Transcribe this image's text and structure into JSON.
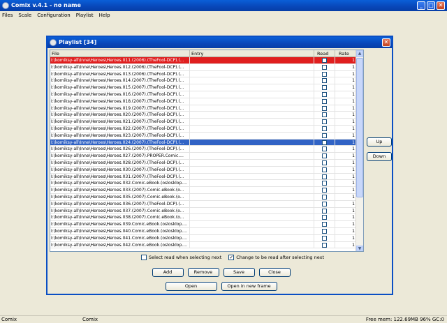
{
  "window": {
    "title": "Comix v.4.1 - no name"
  },
  "menu": [
    "Files",
    "Scale",
    "Configuration",
    "Playlist",
    "Help"
  ],
  "dialog": {
    "title": "Playlist [34]",
    "columns": {
      "file": "File",
      "entry": "Entry",
      "read": "Read",
      "rate": "Rate"
    },
    "rows": [
      {
        "file": "I:\\komiksy-all\\Inne\\Heroes\\Heroes.011.(2006).(TheFool-DCP).(...",
        "rate": "1"
      },
      {
        "file": "I:\\komiksy-all\\Inne\\Heroes\\Heroes.012.(2006).(TheFool-DCP).(...",
        "rate": "1"
      },
      {
        "file": "I:\\komiksy-all\\Inne\\Heroes\\Heroes.013.(2006).(TheFool-DCP).(...",
        "rate": "1"
      },
      {
        "file": "I:\\komiksy-all\\Inne\\Heroes\\Heroes.014.(2007).(TheFool-DCP).(...",
        "rate": "1"
      },
      {
        "file": "I:\\komiksy-all\\Inne\\Heroes\\Heroes.015.(2007).(TheFool-DCP).(...",
        "rate": "1"
      },
      {
        "file": "I:\\komiksy-all\\Inne\\Heroes\\Heroes.016.(2007).(TheFool-DCP).(...",
        "rate": "1"
      },
      {
        "file": "I:\\komiksy-all\\Inne\\Heroes\\Heroes.018.(2007).(TheFool-DCP).(...",
        "rate": "1"
      },
      {
        "file": "I:\\komiksy-all\\Inne\\Heroes\\Heroes.019.(2007).(TheFool-DCP).(...",
        "rate": "1"
      },
      {
        "file": "I:\\komiksy-all\\Inne\\Heroes\\Heroes.020.(2007).(TheFool-DCP).(...",
        "rate": "1"
      },
      {
        "file": "I:\\komiksy-all\\Inne\\Heroes\\Heroes.021.(2007).(TheFool-DCP).(...",
        "rate": "1"
      },
      {
        "file": "I:\\komiksy-all\\Inne\\Heroes\\Heroes.022.(2007).(TheFool-DCP).(...",
        "rate": "1"
      },
      {
        "file": "I:\\komiksy-all\\Inne\\Heroes\\Heroes.023.(2007).(TheFool-DCP).(...",
        "rate": "1"
      },
      {
        "file": "I:\\komiksy-all\\Inne\\Heroes\\Heroes.024.(2007).(TheFool-DCP).(...",
        "rate": "1"
      },
      {
        "file": "I:\\komiksy-all\\Inne\\Heroes\\Heroes.026.(2007).(TheFool-DCP).(...",
        "rate": "1"
      },
      {
        "file": "I:\\komiksy-all\\Inne\\Heroes\\Heroes.027.(2007).PROPER.Comic....",
        "rate": "1"
      },
      {
        "file": "I:\\komiksy-all\\Inne\\Heroes\\Heroes.028.(2007).(TheFool-DCP).(...",
        "rate": "1"
      },
      {
        "file": "I:\\komiksy-all\\Inne\\Heroes\\Heroes.030.(2007).(TheFool-DCP).(...",
        "rate": "1"
      },
      {
        "file": "I:\\komiksy-all\\Inne\\Heroes\\Heroes.031.(2007).(TheFool-DCP).(...",
        "rate": "1"
      },
      {
        "file": "I:\\komiksy-all\\Inne\\Heroes\\Heroes.032.Comic.eBook.(oslosklop....",
        "rate": "1"
      },
      {
        "file": "I:\\komiksy-all\\Inne\\Heroes\\Heroes.033.(2007).Comic.eBook.(o...",
        "rate": "1"
      },
      {
        "file": "I:\\komiksy-all\\Inne\\Heroes\\Heroes.035.(2007).Comic.eBook.(o...",
        "rate": "1"
      },
      {
        "file": "I:\\komiksy-all\\Inne\\Heroes\\Heroes.036.(2007).(TheFool-DCP).(...",
        "rate": "1"
      },
      {
        "file": "I:\\komiksy-all\\Inne\\Heroes\\Heroes.037.(2007).Comic.eBook.(o...",
        "rate": "1"
      },
      {
        "file": "I:\\komiksy-all\\Inne\\Heroes\\Heroes.038.(2007).Comic.eBook.(o...",
        "rate": "1"
      },
      {
        "file": "I:\\komiksy-all\\Inne\\Heroes\\Heroes.039.Comic.eBook.(oslosklop....",
        "rate": "1"
      },
      {
        "file": "I:\\komiksy-all\\Inne\\Heroes\\Heroes.040.Comic.eBook.(oslosklop....",
        "rate": "1"
      },
      {
        "file": "I:\\komiksy-all\\Inne\\Heroes\\Heroes.041.Comic.eBook.(oslosklop....",
        "rate": "1"
      },
      {
        "file": "I:\\komiksy-all\\Inne\\Heroes\\Heroes.042.Comic.eBook.(oslosklop....",
        "rate": "1"
      }
    ],
    "selected_red_row": 0,
    "selected_blue_row": 12,
    "up_label": "Up",
    "down_label": "Down",
    "check_select_read": {
      "label": "Select read when selecting next",
      "checked": false
    },
    "check_change_read": {
      "label": "Change to be read after selecting next",
      "checked": true
    },
    "add_label": "Add",
    "remove_label": "Remove",
    "save_label": "Save",
    "close_label": "Close",
    "open_label": "Open",
    "open_new_frame_label": "Open in new frame"
  },
  "status": {
    "left": "Comix",
    "middle": "Comix",
    "right": "Free mem: 122.69MB 96% GC:0"
  },
  "colors": {
    "titlebar": "#0846b8",
    "selected_red": "#e01e1e",
    "selected_blue": "#3163c5"
  }
}
